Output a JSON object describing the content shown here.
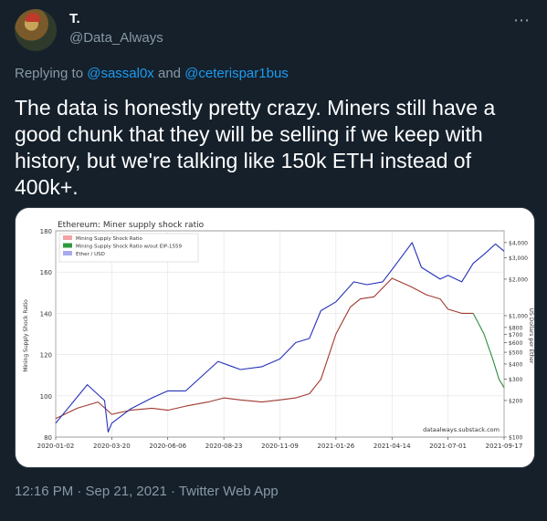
{
  "author": {
    "display_name": "T.",
    "handle": "@Data_Always",
    "avatar_icon": "avatar-photo"
  },
  "more_icon": "ellipsis-icon",
  "reply": {
    "prefix": "Replying to",
    "mention_1": "@sassal0x",
    "joiner": "and",
    "mention_2": "@ceterispar1bus"
  },
  "tweet_text": "The data is honestly pretty crazy. Miners still have a good chunk that they will be selling if we keep with history, but we're talking like 150k ETH instead of 400k+.",
  "timestamp": "12:16 PM · Sep 21, 2021 · Twitter Web App",
  "chart_data": {
    "type": "line",
    "title": "Ethereum: Miner supply shock ratio",
    "ylabel": "Mining Supply Shock Ratio",
    "y2label": "US Dollars per Ether",
    "ylim": [
      80,
      180
    ],
    "yticks": [
      "80",
      "100",
      "120",
      "140",
      "160",
      "180"
    ],
    "y2ticks": [
      "$100",
      "$200",
      "$300",
      "$400",
      "$500",
      "$600",
      "$700",
      "$800",
      "$1,000",
      "$2,000",
      "$3,000",
      "$4,000"
    ],
    "y2_scale": "log",
    "xlim": [
      "2020-01-02",
      "2021-09-17"
    ],
    "xticks": [
      "2020-01-02",
      "2020-03-20",
      "2020-06-06",
      "2020-08-23",
      "2020-11-09",
      "2021-01-26",
      "2021-04-14",
      "2021-07-01",
      "2021-09-17"
    ],
    "legend_position": "top-left",
    "watermark": "dataalways.substack.com",
    "grid": true,
    "series": [
      {
        "name": "Mining Supply Shock Ratio",
        "color": "#a0382e",
        "x": [
          "2020-01-02",
          "2020-02-01",
          "2020-03-01",
          "2020-03-20",
          "2020-04-15",
          "2020-05-15",
          "2020-06-06",
          "2020-07-01",
          "2020-08-01",
          "2020-08-23",
          "2020-09-15",
          "2020-10-15",
          "2020-11-09",
          "2020-12-01",
          "2020-12-20",
          "2021-01-05",
          "2021-01-26",
          "2021-02-15",
          "2021-03-01",
          "2021-03-20",
          "2021-04-14",
          "2021-05-10",
          "2021-06-01",
          "2021-06-20",
          "2021-07-01",
          "2021-07-20",
          "2021-08-05"
        ],
        "y": [
          89,
          94,
          97,
          91,
          93,
          94,
          93,
          95,
          97,
          99,
          98,
          97,
          98,
          99,
          101,
          108,
          130,
          143,
          147,
          148,
          157,
          153,
          149,
          147,
          142,
          140,
          140
        ]
      },
      {
        "name": "Mining Supply Shock Ratio w/out EIP-1559",
        "color": "#2e8b3e",
        "x": [
          "2021-08-05",
          "2021-08-20",
          "2021-09-01",
          "2021-09-10",
          "2021-09-17"
        ],
        "y": [
          140,
          130,
          118,
          108,
          104
        ]
      },
      {
        "name": "Ether / USD",
        "color": "#2330b8",
        "x": [
          "2020-01-02",
          "2020-02-15",
          "2020-03-10",
          "2020-03-15",
          "2020-03-20",
          "2020-04-15",
          "2020-05-15",
          "2020-06-06",
          "2020-07-01",
          "2020-08-15",
          "2020-09-15",
          "2020-10-15",
          "2020-11-09",
          "2020-12-01",
          "2020-12-20",
          "2021-01-05",
          "2021-01-26",
          "2021-02-20",
          "2021-03-10",
          "2021-04-01",
          "2021-04-14",
          "2021-05-12",
          "2021-05-25",
          "2021-06-20",
          "2021-07-01",
          "2021-07-20",
          "2021-08-05",
          "2021-08-20",
          "2021-09-05",
          "2021-09-17"
        ],
        "y": [
          130,
          270,
          200,
          110,
          130,
          170,
          210,
          240,
          240,
          420,
          360,
          380,
          440,
          600,
          650,
          1100,
          1300,
          1900,
          1800,
          1900,
          2400,
          4000,
          2500,
          2000,
          2150,
          1900,
          2700,
          3200,
          3900,
          3400
        ]
      }
    ]
  }
}
